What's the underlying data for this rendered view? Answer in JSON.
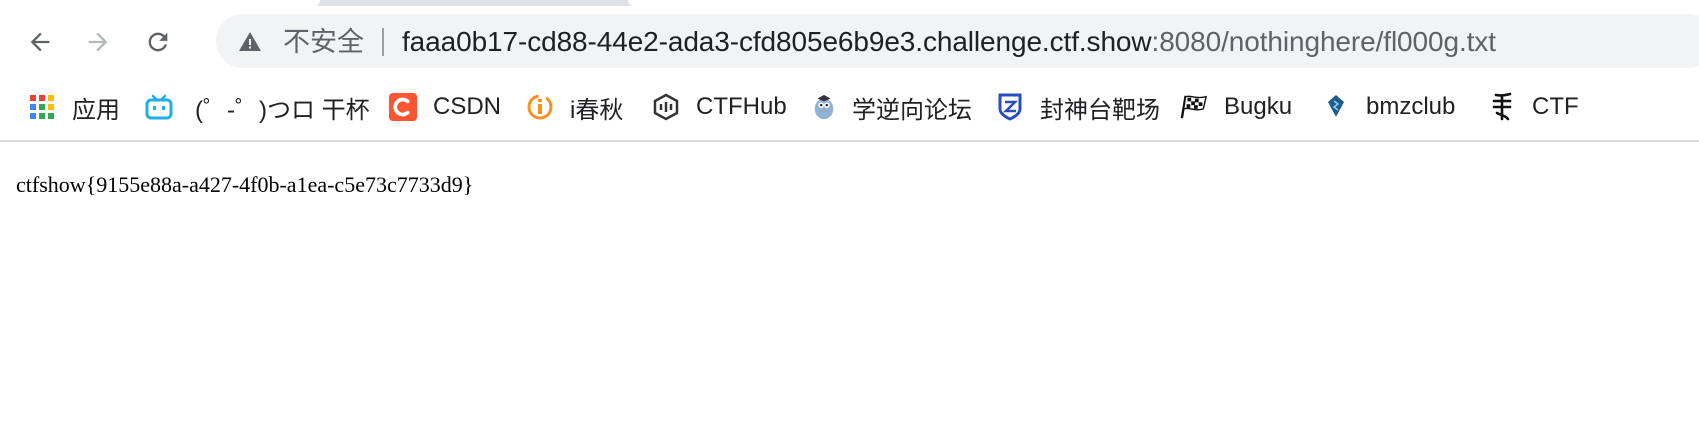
{
  "browser": {
    "security_label": "不安全",
    "url_host": "faaa0b17-cd88-44e2-ada3-cfd805e6b9e3.challenge.ctf.show",
    "url_rest": ":8080/nothinghere/fl000g.txt"
  },
  "bookmarks": [
    {
      "icon": "apps-grid-icon",
      "label": "应用"
    },
    {
      "icon": "bilibili-icon",
      "label": "(゜-゜)つロ 干杯"
    },
    {
      "icon": "csdn-icon",
      "label": "CSDN"
    },
    {
      "icon": "ichunqiu-icon",
      "label": "i春秋"
    },
    {
      "icon": "ctfhub-icon",
      "label": "CTFHub"
    },
    {
      "icon": "reverse-forum-icon",
      "label": "学逆向论坛"
    },
    {
      "icon": "fengshentai-icon",
      "label": "封神台靶场"
    },
    {
      "icon": "checkered-flag-icon",
      "label": "Bugku"
    },
    {
      "icon": "bmzclub-icon",
      "label": "bmzclub"
    },
    {
      "icon": "ctf-icon",
      "label": "CTF"
    }
  ],
  "page": {
    "text": "ctfshow{9155e88a-a427-4f0b-a1ea-c5e73c7733d9}"
  }
}
